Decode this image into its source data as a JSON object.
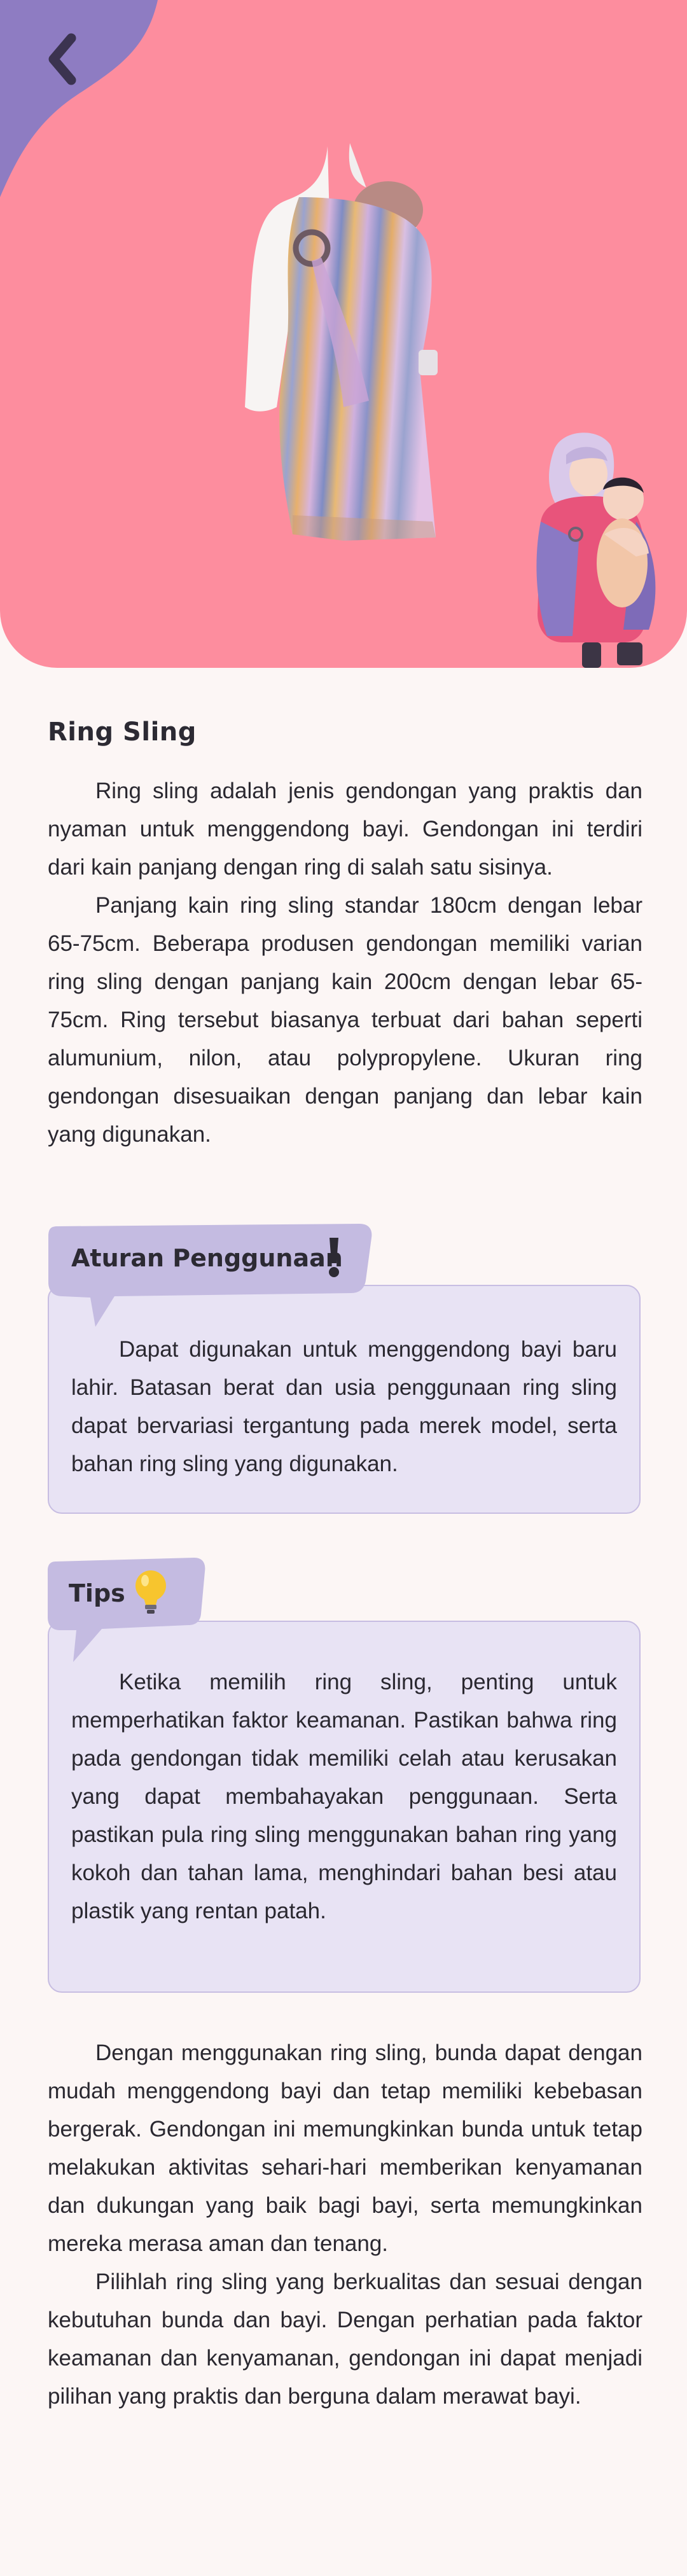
{
  "header": {
    "back_icon": "chevron-left-icon",
    "colors": {
      "hero_bg": "#fd8d9e",
      "blob": "#8e7cc2",
      "accent_card": "#e8e3f4"
    }
  },
  "article": {
    "title": "Ring Sling",
    "intro_paragraphs": [
      "Ring sling adalah jenis gendongan yang praktis dan nyaman untuk menggendong bayi. Gendongan ini terdiri dari kain panjang dengan ring di salah satu sisinya.",
      "Panjang kain ring sling standar 180cm dengan lebar 65-75cm. Beberapa produsen gendongan memiliki varian ring sling dengan panjang kain 200cm dengan lebar 65-75cm. Ring tersebut biasanya terbuat dari bahan seperti alumunium, nilon, atau polypropylene. Ukuran ring gendongan disesuaikan dengan panjang dan lebar kain yang digunakan."
    ],
    "rules": {
      "title": "Aturan Penggunaan",
      "icon": "exclamation-icon",
      "text": "Dapat digunakan untuk menggendong bayi baru lahir. Batasan berat dan usia penggunaan ring sling dapat bervariasi tergantung pada merek model, serta bahan ring sling yang digunakan."
    },
    "tips": {
      "title": "Tips",
      "icon": "lightbulb-icon",
      "text": "Ketika memilih ring sling, penting untuk memperhatikan faktor keamanan. Pastikan bahwa ring pada gendongan tidak memiliki celah atau kerusakan yang dapat membahayakan penggunaan. Serta pastikan pula ring sling menggunakan bahan ring yang kokoh dan tahan lama, menghindari bahan besi atau plastik yang rentan patah."
    },
    "closing_paragraphs": [
      "Dengan menggunakan ring sling, bunda dapat dengan mudah menggendong bayi dan tetap memiliki kebebasan bergerak. Gendongan ini memungkinkan bunda untuk tetap melakukan aktivitas sehari-hari memberikan kenyamanan dan dukungan yang baik bagi bayi, serta memungkinkan mereka merasa aman dan tenang.",
      "Pilihlah ring sling yang berkualitas dan sesuai dengan kebutuhan bunda dan bayi. Dengan perhatian pada faktor keamanan dan kenyamanan, gendongan ini dapat menjadi pilihan yang praktis dan berguna dalam merawat bayi."
    ]
  }
}
